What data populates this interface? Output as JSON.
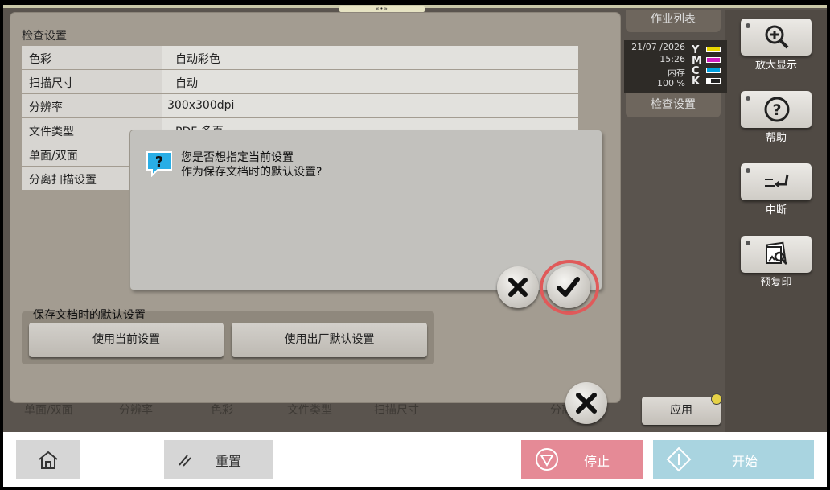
{
  "top_handle": "«•»",
  "tabs": {
    "job_list": "作业列表",
    "check_settings": "检查设置"
  },
  "status": {
    "date": "21/07 /2026",
    "time": "15:26",
    "memory_label": "内存",
    "memory_value": "100 %",
    "toner": [
      {
        "letter": "Y",
        "color": "#e8d600"
      },
      {
        "letter": "M",
        "color": "#d020c0"
      },
      {
        "letter": "C",
        "color": "#00a0e0"
      },
      {
        "letter": "K",
        "color": "#222222"
      }
    ]
  },
  "side_buttons": [
    {
      "icon": "zoom-in-icon",
      "label": "放大显示"
    },
    {
      "icon": "help-icon",
      "label": "帮助"
    },
    {
      "icon": "interrupt-icon",
      "label": "中断"
    },
    {
      "icon": "preview-icon",
      "label": "预复印"
    }
  ],
  "panel": {
    "title": "检查设置",
    "rows": [
      {
        "label": "色彩",
        "value": "自动彩色"
      },
      {
        "label": "扫描尺寸",
        "value": "自动"
      },
      {
        "label": "分辨率",
        "value": "300x300dpi"
      },
      {
        "label": "文件类型",
        "value": "PDF 多页"
      },
      {
        "label": "单面/双面",
        "value": ""
      },
      {
        "label": "分离扫描设置",
        "value": ""
      }
    ],
    "defaults": {
      "title": "保存文档时的默认设置",
      "use_current": "使用当前设置",
      "use_factory": "使用出厂默认设置"
    },
    "bottom_tabs": [
      "单面/双面",
      "分辨率",
      "色彩",
      "文件类型",
      "扫描尺寸",
      "分离"
    ]
  },
  "dialog": {
    "line1": "您是否想指定当前设置",
    "line2": "作为保存文档时的默认设置?",
    "icon": "question-icon"
  },
  "apply": "应用",
  "footer": {
    "home_icon": "home-icon",
    "reset": "重置",
    "stop": "停止",
    "start": "开始",
    "stop_color": "#e58a96",
    "start_color": "#a9d4e0"
  }
}
